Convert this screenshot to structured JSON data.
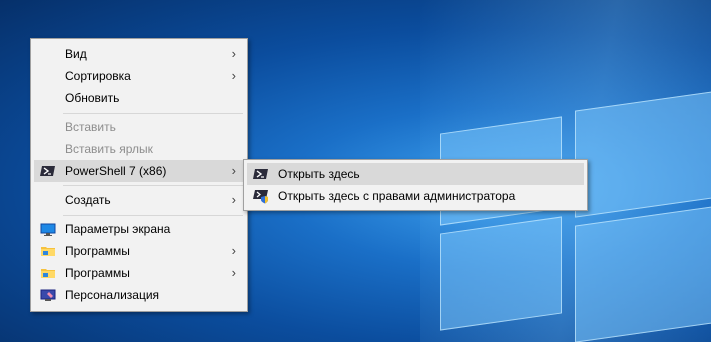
{
  "context_menu": {
    "items": [
      {
        "label": "Вид",
        "submenu": true
      },
      {
        "label": "Сортировка",
        "submenu": true
      },
      {
        "label": "Обновить"
      },
      {
        "label": "Вставить",
        "disabled": true
      },
      {
        "label": "Вставить ярлык",
        "disabled": true
      },
      {
        "label": "PowerShell 7 (x86)",
        "submenu": true,
        "icon": "powershell-icon",
        "highlighted": true
      },
      {
        "label": "Создать",
        "submenu": true
      },
      {
        "label": "Параметры экрана",
        "icon": "display-settings-icon"
      },
      {
        "label": "Программы",
        "submenu": true,
        "icon": "folder-icon"
      },
      {
        "label": "Программы",
        "submenu": true,
        "icon": "folder-icon"
      },
      {
        "label": "Персонализация",
        "icon": "personalization-icon"
      }
    ]
  },
  "submenu": {
    "items": [
      {
        "label": "Открыть здесь",
        "icon": "powershell-icon",
        "highlighted": true
      },
      {
        "label": "Открыть здесь с правами администратора",
        "icon": "powershell-admin-icon"
      }
    ]
  },
  "colors": {
    "desktop_accent": "#1a6fc7",
    "menu_background": "#f2f2f2",
    "menu_highlight": "#d9d9d9",
    "disabled_text": "#8d8d8d"
  }
}
